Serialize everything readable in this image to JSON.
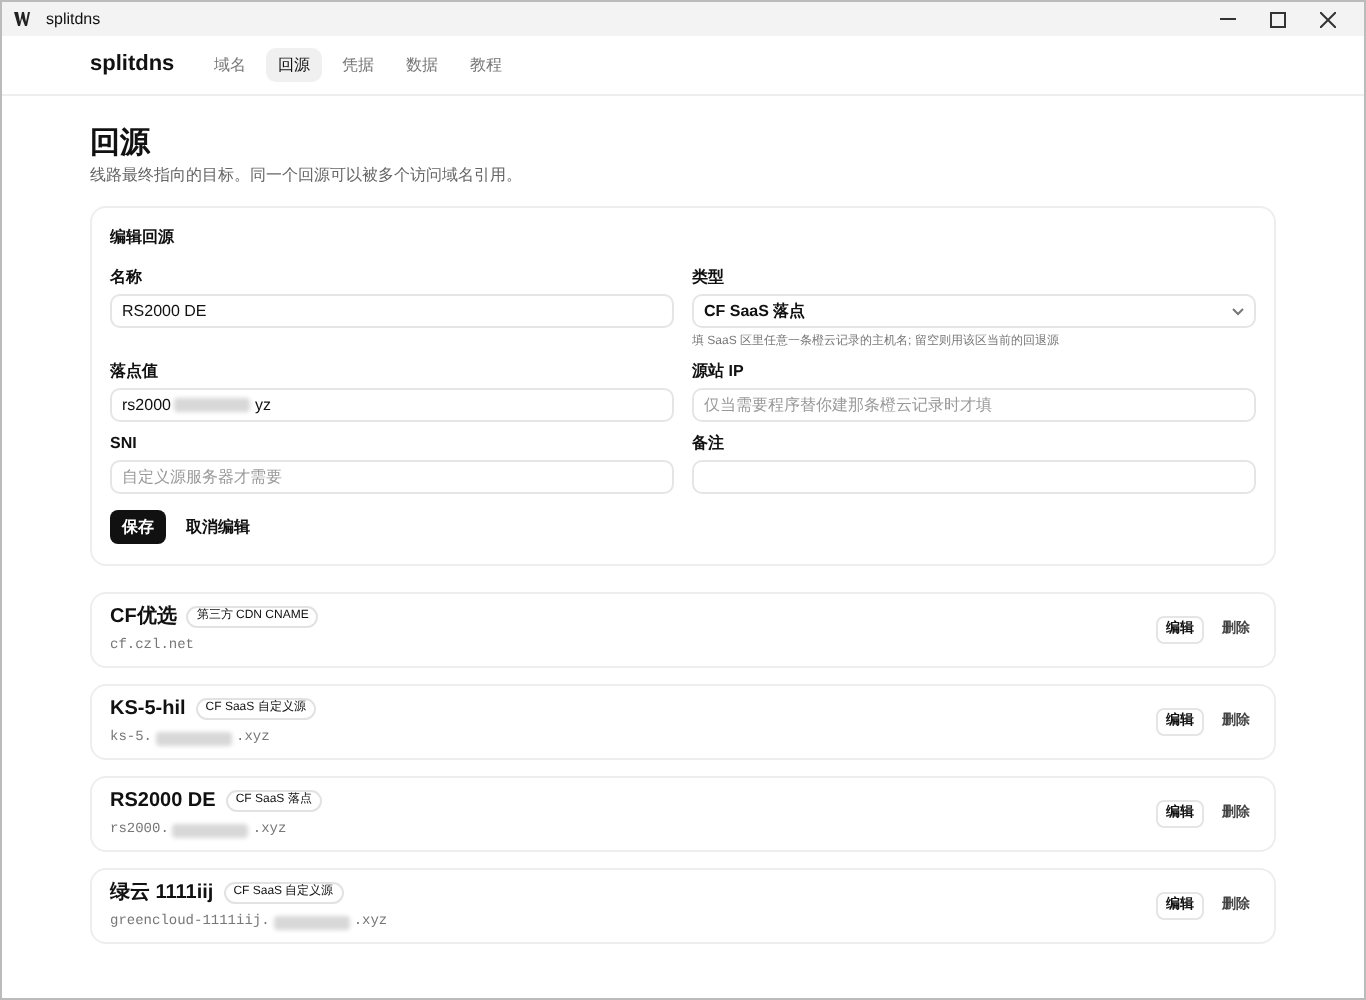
{
  "window": {
    "title": "splitdns"
  },
  "nav": {
    "brand": "splitdns",
    "tabs": [
      {
        "label": "域名",
        "selected": false
      },
      {
        "label": "回源",
        "selected": true
      },
      {
        "label": "凭据",
        "selected": false
      },
      {
        "label": "数据",
        "selected": false
      },
      {
        "label": "教程",
        "selected": false
      }
    ]
  },
  "page": {
    "title": "回源",
    "subtitle": "线路最终指向的目标。同一个回源可以被多个访问域名引用。"
  },
  "form": {
    "title": "编辑回源",
    "fields": [
      {
        "kind": "input",
        "label": "名称",
        "value": "RS2000 DE"
      },
      {
        "kind": "select",
        "label": "类型",
        "value": "CF SaaS 落点",
        "hint": "填 SaaS 区里任意一条橙云记录的主机名; 留空则用该区当前的回退源"
      },
      {
        "kind": "redacted",
        "label": "落点值",
        "value_prefix": "rs2000",
        "value_suffix": "yz"
      },
      {
        "kind": "input",
        "label": "源站 IP",
        "placeholder": "仅当需要程序替你建那条橙云记录时才填"
      },
      {
        "kind": "input",
        "label": "SNI",
        "placeholder": "自定义源服务器才需要"
      },
      {
        "kind": "input",
        "label": "备注"
      }
    ],
    "save_button": "保存",
    "cancel_button": "取消编辑"
  },
  "origins": [
    {
      "name": "CF优选",
      "tag": "第三方 CDN CNAME",
      "target_prefix": "cf.czl.net",
      "edit": "编辑",
      "delete": "删除"
    },
    {
      "name": "KS-5-hil",
      "tag": "CF SaaS 自定义源",
      "target_prefix": "ks-5.",
      "target_suffix": ".xyz",
      "edit": "编辑",
      "delete": "删除"
    },
    {
      "name": "RS2000 DE",
      "tag": "CF SaaS 落点",
      "target_prefix": "rs2000.",
      "target_suffix": ".xyz",
      "edit": "编辑",
      "delete": "删除"
    },
    {
      "name": "绿云 1111iij",
      "tag": "CF SaaS 自定义源",
      "target_prefix": "greencloud-1111iij.",
      "target_suffix": ".xyz",
      "edit": "编辑",
      "delete": "删除"
    }
  ]
}
